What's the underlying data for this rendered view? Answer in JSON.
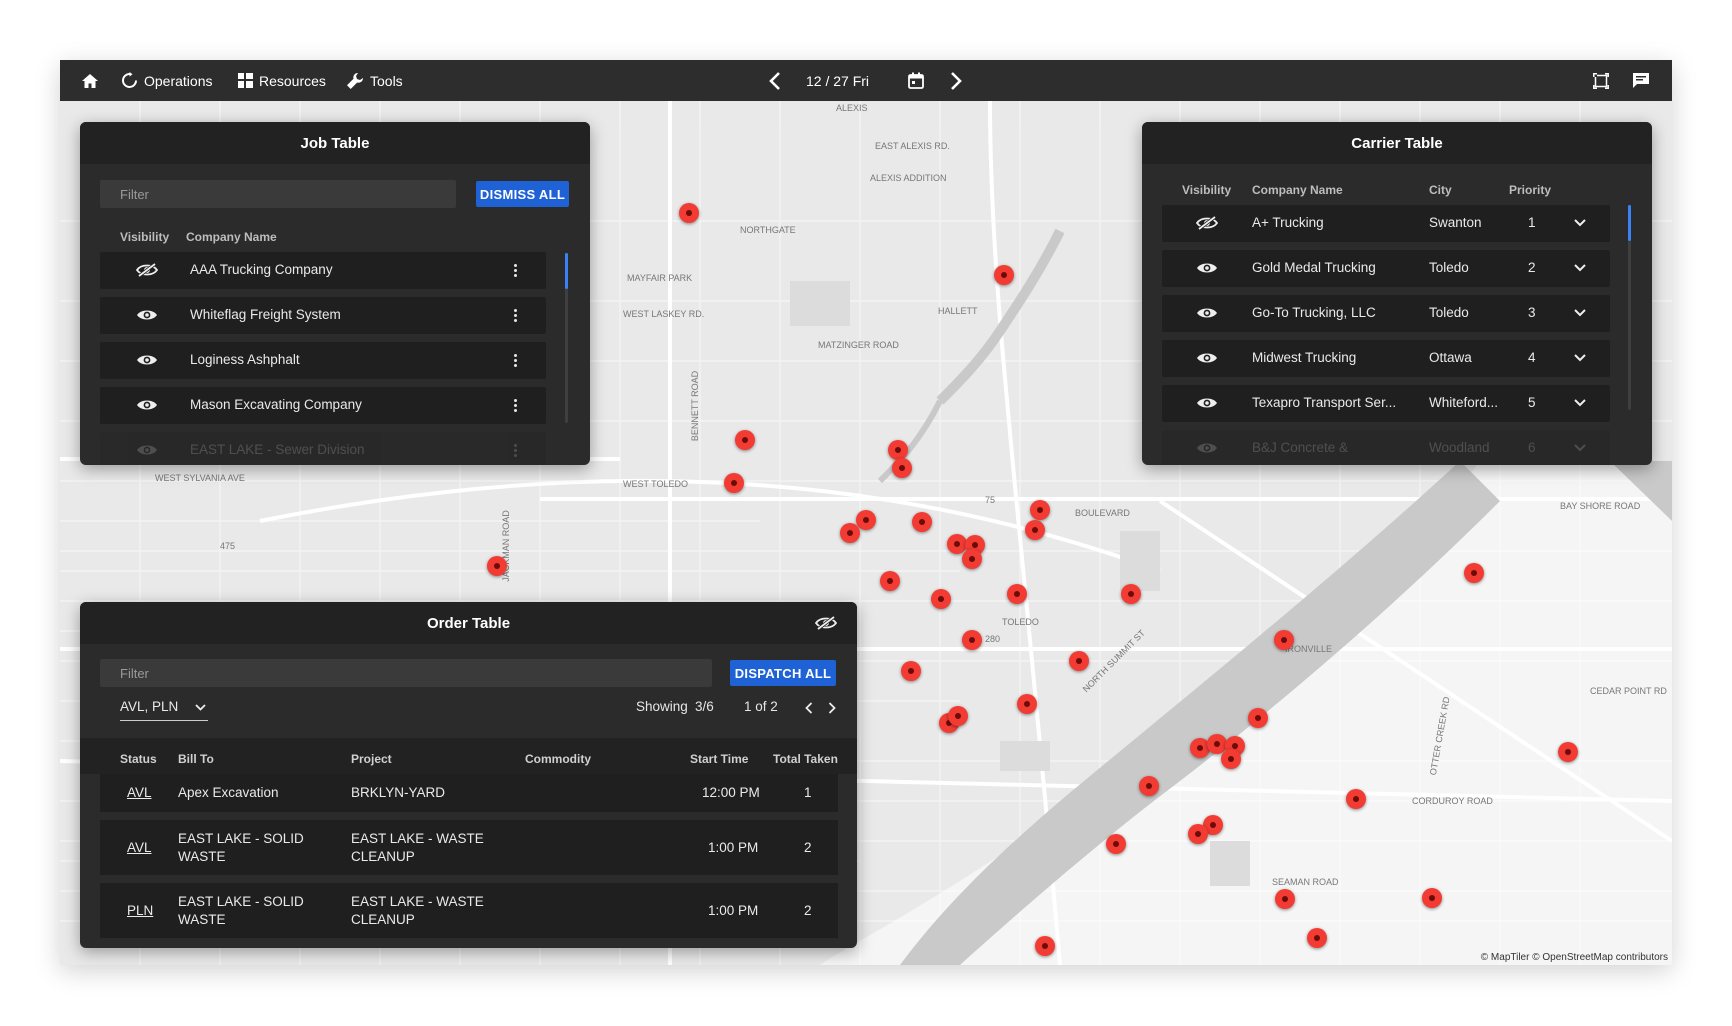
{
  "topbar": {
    "nav": [
      {
        "label": "Operations",
        "icon": "refresh-icon"
      },
      {
        "label": "Resources",
        "icon": "grid-icon"
      },
      {
        "label": "Tools",
        "icon": "wrench-icon"
      }
    ],
    "date": "12 / 27 Fri"
  },
  "job_table": {
    "title": "Job Table",
    "filter_placeholder": "Filter",
    "dismiss_label": "DISMISS ALL",
    "columns": [
      "Visibility",
      "Company Name"
    ],
    "rows": [
      {
        "name": "AAA Trucking Company",
        "visible": false
      },
      {
        "name": "Whiteflag Freight System",
        "visible": true
      },
      {
        "name": "Loginess Ashphalt",
        "visible": true
      },
      {
        "name": "Mason Excavating Company",
        "visible": true
      },
      {
        "name": "EAST LAKE - Sewer Division",
        "visible": true
      }
    ]
  },
  "carrier_table": {
    "title": "Carrier Table",
    "columns": [
      "Visibility",
      "Company Name",
      "City",
      "Priority"
    ],
    "rows": [
      {
        "name": "A+ Trucking",
        "city": "Swanton",
        "priority": "1",
        "visible": false
      },
      {
        "name": "Gold Medal Trucking",
        "city": "Toledo",
        "priority": "2",
        "visible": true
      },
      {
        "name": "Go-To Trucking, LLC",
        "city": "Toledo",
        "priority": "3",
        "visible": true
      },
      {
        "name": "Midwest Trucking",
        "city": "Ottawa",
        "priority": "4",
        "visible": true
      },
      {
        "name": "Texapro Transport Ser...",
        "city": "Whiteford...",
        "priority": "5",
        "visible": true
      },
      {
        "name": "B&J Concrete &",
        "city": "Woodland",
        "priority": "6",
        "visible": true
      }
    ]
  },
  "order_table": {
    "title": "Order Table",
    "filter_placeholder": "Filter",
    "dispatch_label": "DISPATCH ALL",
    "status_filter": "AVL, PLN",
    "showing_label": "Showing",
    "showing_value": "3/6",
    "page": "1 of 2",
    "columns": [
      "Status",
      "Bill To",
      "Project",
      "Commodity",
      "Start Time",
      "Total Taken"
    ],
    "rows": [
      {
        "status": "AVL",
        "bill_to": "Apex Excavation",
        "project": "BRKLYN-YARD",
        "commodity": "",
        "start": "12:00 PM",
        "total": "1"
      },
      {
        "status": "AVL",
        "bill_to": "EAST LAKE - SOLID WASTE",
        "project": "EAST LAKE - WASTE CLEANUP",
        "commodity": "",
        "start": "1:00 PM",
        "total": "2"
      },
      {
        "status": "PLN",
        "bill_to": "EAST LAKE - SOLID WASTE",
        "project": "EAST LAKE - WASTE CLEANUP",
        "commodity": "",
        "start": "1:00 PM",
        "total": "2"
      }
    ]
  },
  "map": {
    "labels": [
      "ALEXIS",
      "EAST ALEXIS RD.",
      "ALEXIS ADDITION",
      "NORTHGATE",
      "MAYFAIR PARK",
      "WEST LASKEY RD.",
      "HALLETT",
      "MATZINGER ROAD",
      "BENNETT ROAD",
      "WEST SYLVANIA AVE",
      "WEST TOLEDO",
      "BOULEVARD",
      "TOLEDO",
      "NORTH SUMMIT ST",
      "IRONVILLE",
      "CEDAR POINT RD",
      "BAY SHORE ROAD",
      "CORDUROY ROAD",
      "SEAMAN ROAD",
      "OTTER CREEK RD",
      "JACKMAN ROAD",
      "475",
      "75",
      "280"
    ],
    "attribution": "© MapTiler © OpenStreetMap contributors",
    "pin_color": "#f13b33"
  },
  "colors": {
    "accent": "#1e62d6",
    "panel": "#2b2b2b",
    "topbar": "#2d2d2d"
  }
}
